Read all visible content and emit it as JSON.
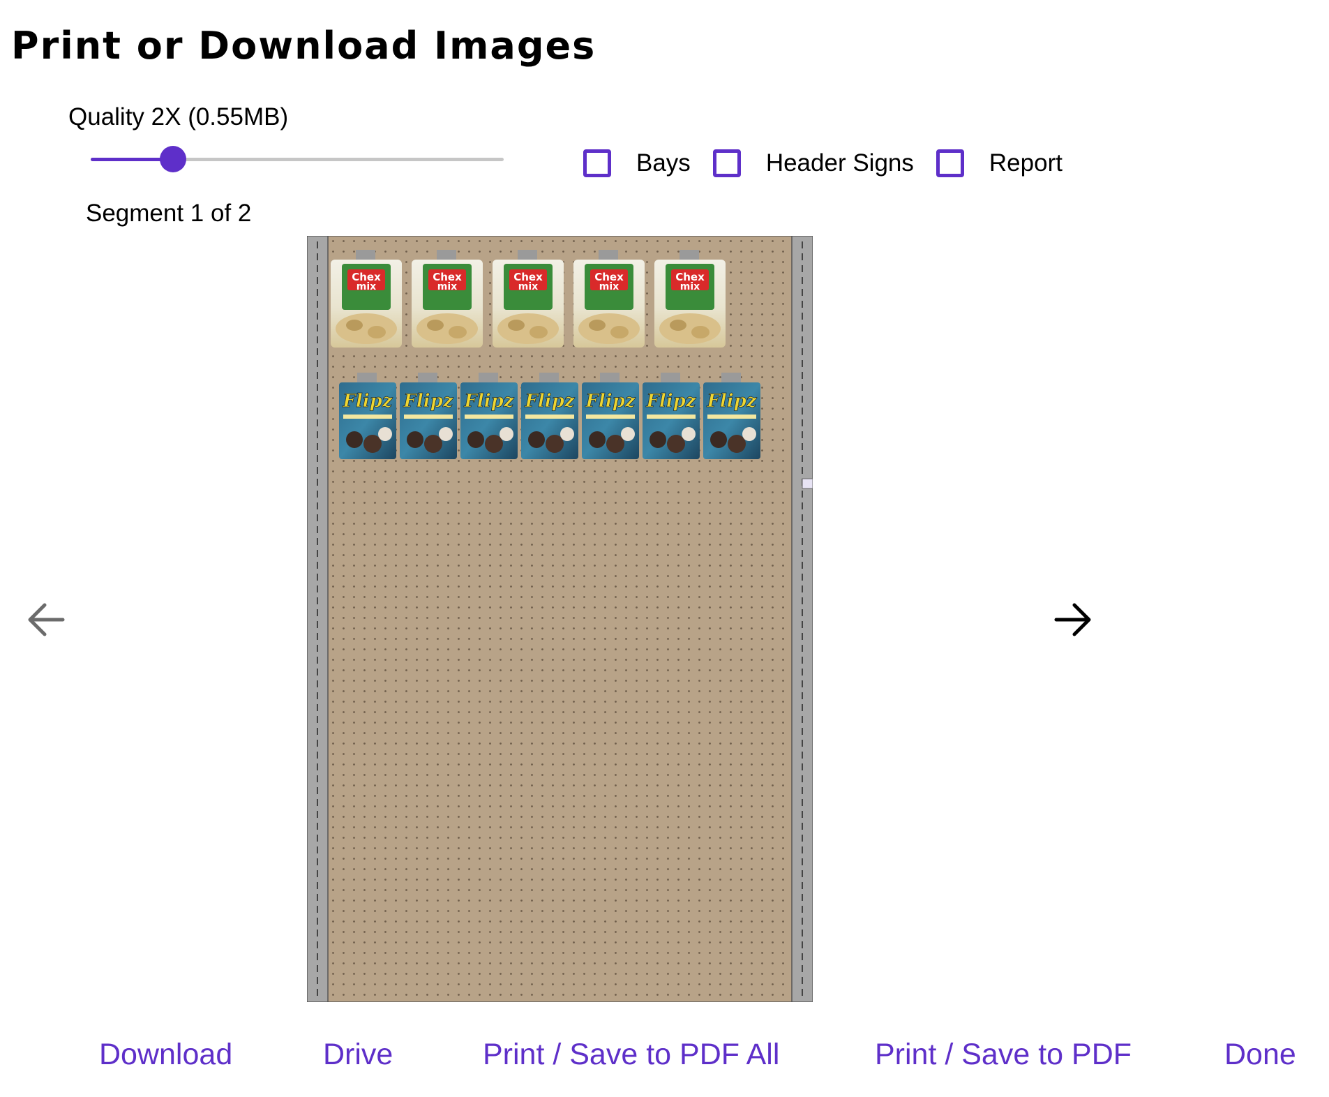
{
  "header": {
    "title": "Print or Download Images"
  },
  "quality": {
    "label": "Quality 2X (0.55MB)",
    "value_fraction": 0.2
  },
  "options": [
    {
      "label": "Bays",
      "checked": true
    },
    {
      "label": "Header Signs",
      "checked": false
    },
    {
      "label": "Report",
      "checked": false
    }
  ],
  "segment": {
    "label": "Segment 1 of 2"
  },
  "preview": {
    "products_row1": {
      "brand": "Chex mix",
      "count": 5
    },
    "products_row2": {
      "brand": "Flipz",
      "count": 7
    }
  },
  "nav": {
    "prev_icon": "arrow-left-icon",
    "next_icon": "arrow-right-icon"
  },
  "actions": {
    "download": "Download",
    "drive": "Drive",
    "print_all": "Print / Save to PDF All",
    "print": "Print / Save to PDF",
    "done": "Done"
  },
  "colors": {
    "accent": "#5e2fc9",
    "pegboard": "#b8a388"
  }
}
